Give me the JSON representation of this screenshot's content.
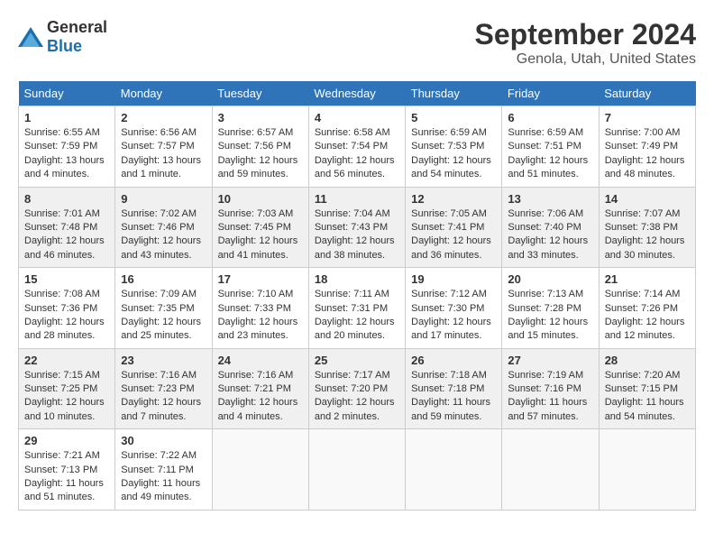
{
  "header": {
    "logo_general": "General",
    "logo_blue": "Blue",
    "month_year": "September 2024",
    "location": "Genola, Utah, United States"
  },
  "days_of_week": [
    "Sunday",
    "Monday",
    "Tuesday",
    "Wednesday",
    "Thursday",
    "Friday",
    "Saturday"
  ],
  "weeks": [
    [
      {
        "day": "1",
        "sunrise": "6:55 AM",
        "sunset": "7:59 PM",
        "daylight": "13 hours and 4 minutes."
      },
      {
        "day": "2",
        "sunrise": "6:56 AM",
        "sunset": "7:57 PM",
        "daylight": "13 hours and 1 minute."
      },
      {
        "day": "3",
        "sunrise": "6:57 AM",
        "sunset": "7:56 PM",
        "daylight": "12 hours and 59 minutes."
      },
      {
        "day": "4",
        "sunrise": "6:58 AM",
        "sunset": "7:54 PM",
        "daylight": "12 hours and 56 minutes."
      },
      {
        "day": "5",
        "sunrise": "6:59 AM",
        "sunset": "7:53 PM",
        "daylight": "12 hours and 54 minutes."
      },
      {
        "day": "6",
        "sunrise": "6:59 AM",
        "sunset": "7:51 PM",
        "daylight": "12 hours and 51 minutes."
      },
      {
        "day": "7",
        "sunrise": "7:00 AM",
        "sunset": "7:49 PM",
        "daylight": "12 hours and 48 minutes."
      }
    ],
    [
      {
        "day": "8",
        "sunrise": "7:01 AM",
        "sunset": "7:48 PM",
        "daylight": "12 hours and 46 minutes."
      },
      {
        "day": "9",
        "sunrise": "7:02 AM",
        "sunset": "7:46 PM",
        "daylight": "12 hours and 43 minutes."
      },
      {
        "day": "10",
        "sunrise": "7:03 AM",
        "sunset": "7:45 PM",
        "daylight": "12 hours and 41 minutes."
      },
      {
        "day": "11",
        "sunrise": "7:04 AM",
        "sunset": "7:43 PM",
        "daylight": "12 hours and 38 minutes."
      },
      {
        "day": "12",
        "sunrise": "7:05 AM",
        "sunset": "7:41 PM",
        "daylight": "12 hours and 36 minutes."
      },
      {
        "day": "13",
        "sunrise": "7:06 AM",
        "sunset": "7:40 PM",
        "daylight": "12 hours and 33 minutes."
      },
      {
        "day": "14",
        "sunrise": "7:07 AM",
        "sunset": "7:38 PM",
        "daylight": "12 hours and 30 minutes."
      }
    ],
    [
      {
        "day": "15",
        "sunrise": "7:08 AM",
        "sunset": "7:36 PM",
        "daylight": "12 hours and 28 minutes."
      },
      {
        "day": "16",
        "sunrise": "7:09 AM",
        "sunset": "7:35 PM",
        "daylight": "12 hours and 25 minutes."
      },
      {
        "day": "17",
        "sunrise": "7:10 AM",
        "sunset": "7:33 PM",
        "daylight": "12 hours and 23 minutes."
      },
      {
        "day": "18",
        "sunrise": "7:11 AM",
        "sunset": "7:31 PM",
        "daylight": "12 hours and 20 minutes."
      },
      {
        "day": "19",
        "sunrise": "7:12 AM",
        "sunset": "7:30 PM",
        "daylight": "12 hours and 17 minutes."
      },
      {
        "day": "20",
        "sunrise": "7:13 AM",
        "sunset": "7:28 PM",
        "daylight": "12 hours and 15 minutes."
      },
      {
        "day": "21",
        "sunrise": "7:14 AM",
        "sunset": "7:26 PM",
        "daylight": "12 hours and 12 minutes."
      }
    ],
    [
      {
        "day": "22",
        "sunrise": "7:15 AM",
        "sunset": "7:25 PM",
        "daylight": "12 hours and 10 minutes."
      },
      {
        "day": "23",
        "sunrise": "7:16 AM",
        "sunset": "7:23 PM",
        "daylight": "12 hours and 7 minutes."
      },
      {
        "day": "24",
        "sunrise": "7:16 AM",
        "sunset": "7:21 PM",
        "daylight": "12 hours and 4 minutes."
      },
      {
        "day": "25",
        "sunrise": "7:17 AM",
        "sunset": "7:20 PM",
        "daylight": "12 hours and 2 minutes."
      },
      {
        "day": "26",
        "sunrise": "7:18 AM",
        "sunset": "7:18 PM",
        "daylight": "11 hours and 59 minutes."
      },
      {
        "day": "27",
        "sunrise": "7:19 AM",
        "sunset": "7:16 PM",
        "daylight": "11 hours and 57 minutes."
      },
      {
        "day": "28",
        "sunrise": "7:20 AM",
        "sunset": "7:15 PM",
        "daylight": "11 hours and 54 minutes."
      }
    ],
    [
      {
        "day": "29",
        "sunrise": "7:21 AM",
        "sunset": "7:13 PM",
        "daylight": "11 hours and 51 minutes."
      },
      {
        "day": "30",
        "sunrise": "7:22 AM",
        "sunset": "7:11 PM",
        "daylight": "11 hours and 49 minutes."
      },
      null,
      null,
      null,
      null,
      null
    ]
  ]
}
